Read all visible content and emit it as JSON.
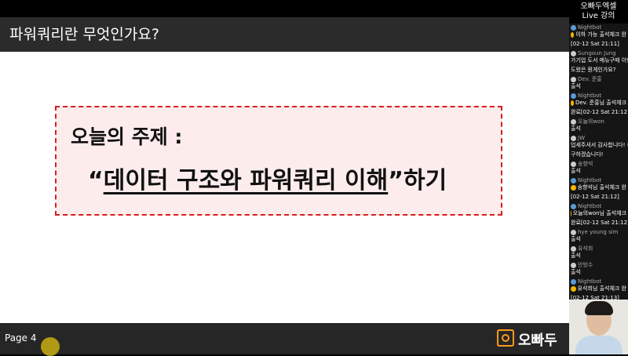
{
  "channel": {
    "title_line1": "오빠두엑셀",
    "title_line2": "Live 강의"
  },
  "slide": {
    "header_title": "파워쿼리란 무엇인가요?",
    "topic_label": "오늘의 주제 :",
    "topic_open_quote": "“",
    "topic_main": "데이터 구조와 파워쿼리 이해",
    "topic_close_quote": "”하기"
  },
  "footer": {
    "page": "Page 4",
    "logo_text": "오빠두"
  },
  "chat": [
    {
      "author": "Nightbot",
      "bot": true,
      "text": "이하 가능 출석체크 완"
    },
    {
      "author": "",
      "bot": false,
      "text": "[02-12 Sat 21:11]"
    },
    {
      "author": "Sungoun Jung",
      "bot": false,
      "text": "가기업 도서 메뉴구매 이번"
    },
    {
      "author": "",
      "bot": false,
      "text": "도왔은 뭔게인가요?"
    },
    {
      "author": "Dev. 준홍",
      "bot": false,
      "text": "출석"
    },
    {
      "author": "Nightbot",
      "bot": true,
      "text": "Dev. 준홍님 출석체크"
    },
    {
      "author": "",
      "bot": false,
      "text": "완료[02-12 Sat 21:12]"
    },
    {
      "author": "오늘의won",
      "bot": false,
      "text": "출석"
    },
    {
      "author": "JW",
      "bot": false,
      "text": "업세주셔서 감사합니다! 참"
    },
    {
      "author": "",
      "bot": false,
      "text": "구하겠습니다!"
    },
    {
      "author": "송향석",
      "bot": false,
      "text": "출석"
    },
    {
      "author": "Nightbot",
      "bot": true,
      "text": "송향석님 출석체크 완"
    },
    {
      "author": "",
      "bot": false,
      "text": "[02-12 Sat 21:12]"
    },
    {
      "author": "Nightbot",
      "bot": true,
      "text": "오늘의won님 출석체크"
    },
    {
      "author": "",
      "bot": false,
      "text": "완료[02-12 Sat 21:12]"
    },
    {
      "author": "hye young sim",
      "bot": false,
      "text": "출석"
    },
    {
      "author": "유석희",
      "bot": false,
      "text": "출석"
    },
    {
      "author": "안방수",
      "bot": false,
      "text": "출석"
    },
    {
      "author": "Nightbot",
      "bot": true,
      "text": "유석희님 출석체크 완"
    },
    {
      "author": "",
      "bot": false,
      "text": "[02-12 Sat 21:13]"
    }
  ]
}
